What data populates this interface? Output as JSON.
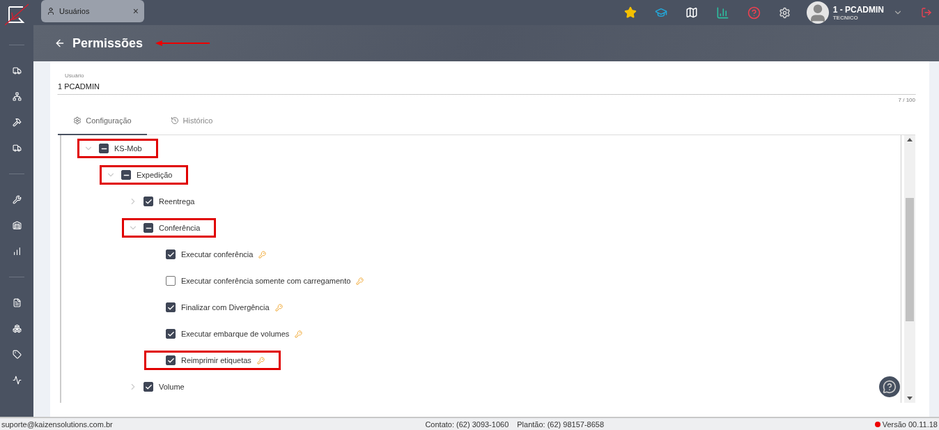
{
  "top_tab": {
    "label": "Usuários",
    "close": "×"
  },
  "user": {
    "name": "1 - PCADMIN",
    "role": "TECNICO"
  },
  "page": {
    "title": "Permissões"
  },
  "user_field": {
    "label": "Usuário",
    "value": "1 PCADMIN",
    "counter": "7 / 100"
  },
  "tabs": [
    {
      "label": "Configuração",
      "selected": true,
      "kind": "settings"
    },
    {
      "label": "Histórico",
      "selected": false,
      "kind": "history"
    }
  ],
  "tree": [
    {
      "label": "KS-Mob",
      "indeterminate": true,
      "expanded": true,
      "highlighted": true,
      "children": [
        {
          "label": "Expedição",
          "indeterminate": true,
          "expanded": true,
          "highlighted": true,
          "children": [
            {
              "label": "Reentrega",
              "checked": true,
              "expanded": false,
              "highlighted": false
            },
            {
              "label": "Conferência",
              "indeterminate": true,
              "expanded": true,
              "highlighted": true,
              "children": [
                {
                  "label": "Executar conferência",
                  "checked": true,
                  "restricted": true,
                  "highlighted": false
                },
                {
                  "label": "Executar conferência somente com carregamento",
                  "checked": false,
                  "restricted": true,
                  "highlighted": false
                },
                {
                  "label": "Finalizar com Divergência",
                  "checked": true,
                  "restricted": true,
                  "highlighted": false
                },
                {
                  "label": "Executar embarque de volumes",
                  "checked": true,
                  "restricted": true,
                  "highlighted": false
                },
                {
                  "label": "Reimprimir etiquetas",
                  "checked": true,
                  "restricted": true,
                  "highlighted": true
                }
              ]
            },
            {
              "label": "Volume",
              "checked": true,
              "expanded": false,
              "highlighted": false
            }
          ]
        }
      ]
    }
  ],
  "status_bar": {
    "email": "suporte@kaizensolutions.com.br",
    "contact": "Contato: (62) 3093-1060",
    "duty": "Plantão: (62) 98157-8658",
    "version": "Versão 00.11.18"
  }
}
